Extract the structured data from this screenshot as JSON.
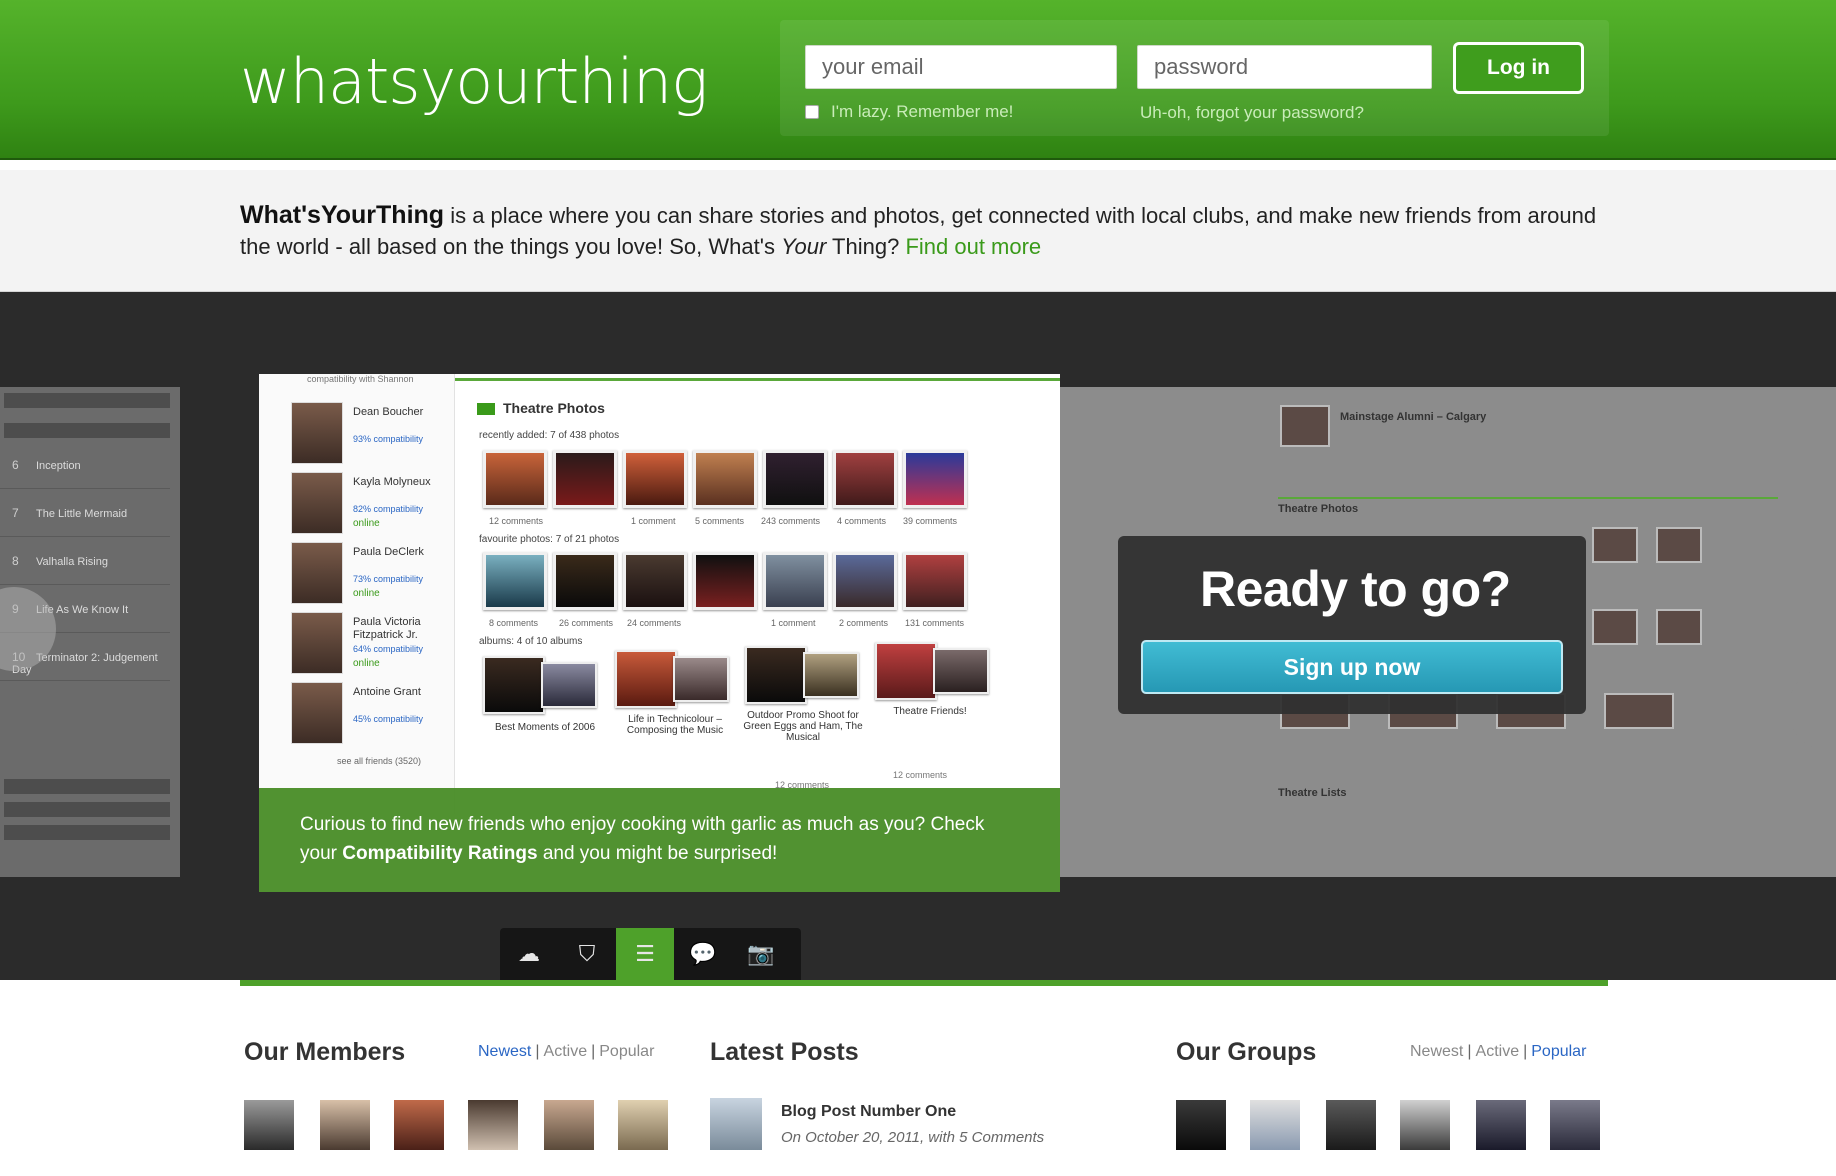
{
  "header": {
    "logo": "whatsyourthing",
    "email_placeholder": "your email",
    "password_placeholder": "password",
    "login_label": "Log in",
    "remember_label": "I'm lazy. Remember me!",
    "forgot_label": "Uh-oh, forgot your password?"
  },
  "intro": {
    "brand": "What'sYourThing",
    "text_1": " is a place where you can share stories and photos, get connected with local clubs, and make new friends from around the world - all based on the things you love! So, What's ",
    "text_em": "Your",
    "text_2": " Thing? ",
    "link": "Find out more"
  },
  "ready": {
    "title": "Ready to go?",
    "signup_label": "Sign up now"
  },
  "slide": {
    "top_link": "compatibility with Shannon",
    "friends": [
      {
        "name": "Dean Boucher",
        "compat": "93% compatibility",
        "online": ""
      },
      {
        "name": "Kayla Molyneux",
        "compat": "82% compatibility",
        "online": "online"
      },
      {
        "name": "Paula DeClerk",
        "compat": "73% compatibility",
        "online": "online"
      },
      {
        "name": "Paula Victoria Fitzpatrick Jr.",
        "compat": "64% compatibility",
        "online": "online"
      },
      {
        "name": "Antoine Grant",
        "compat": "45% compatibility",
        "online": ""
      }
    ],
    "see_all": "see all friends (3520)",
    "section_title": "Theatre Photos",
    "recent_label": "recently added: 7 of 438 photos",
    "recent_caps": [
      "12 comments",
      "",
      "1 comment",
      "5 comments",
      "243 comments",
      "4 comments",
      "39 comments"
    ],
    "fav_label": "favourite photos: 7 of 21 photos",
    "fav_caps": [
      "8 comments",
      "26 comments",
      "24 comments",
      "",
      "1 comment",
      "2 comments",
      "131 comments"
    ],
    "albums_label": "albums: 4 of 10 albums",
    "albums": [
      {
        "title": "Best Moments of 2006",
        "meta": ""
      },
      {
        "title": "Life in Technicolour – Composing the Music",
        "meta": ""
      },
      {
        "title": "Outdoor Promo Shoot for Green Eggs and Ham, The Musical",
        "meta": "12 comments"
      },
      {
        "title": "Theatre Friends!",
        "meta": "12 comments"
      }
    ],
    "caption_1": "Curious to find new friends who enjoy cooking with garlic as much as you? Check your ",
    "caption_bold": "Compatibility Ratings",
    "caption_2": " and you might be surprised!"
  },
  "bg_left": {
    "items": [
      {
        "num": "6",
        "label": "Inception"
      },
      {
        "num": "7",
        "label": "The Little Mermaid"
      },
      {
        "num": "8",
        "label": "Valhalla Rising"
      },
      {
        "num": "9",
        "label": "Life As We Know It"
      },
      {
        "num": "10",
        "label": "Terminator 2: Judgement Day"
      }
    ]
  },
  "bg_right": {
    "club": "Mainstage Alumni – Calgary",
    "section": "Theatre Photos",
    "lists": "Theatre Lists"
  },
  "nav_icons": [
    "cloud-icon",
    "shield-icon",
    "list-icon",
    "speech-bubble-icon",
    "camera-icon"
  ],
  "members": {
    "title": "Our Members",
    "filters": [
      "Newest",
      "Active",
      "Popular"
    ],
    "active_filter": "Newest"
  },
  "posts": {
    "title": "Latest Posts",
    "item_title": "Blog Post Number One",
    "item_meta": "On October 20, 2011, with 5 Comments"
  },
  "groups": {
    "title": "Our Groups",
    "filters": [
      "Newest",
      "Active",
      "Popular"
    ],
    "active_filter": "Popular"
  },
  "colors": {
    "brand_green": "#4ea12a",
    "link_blue": "#2a66c4",
    "signup_teal": "#2698b4"
  }
}
